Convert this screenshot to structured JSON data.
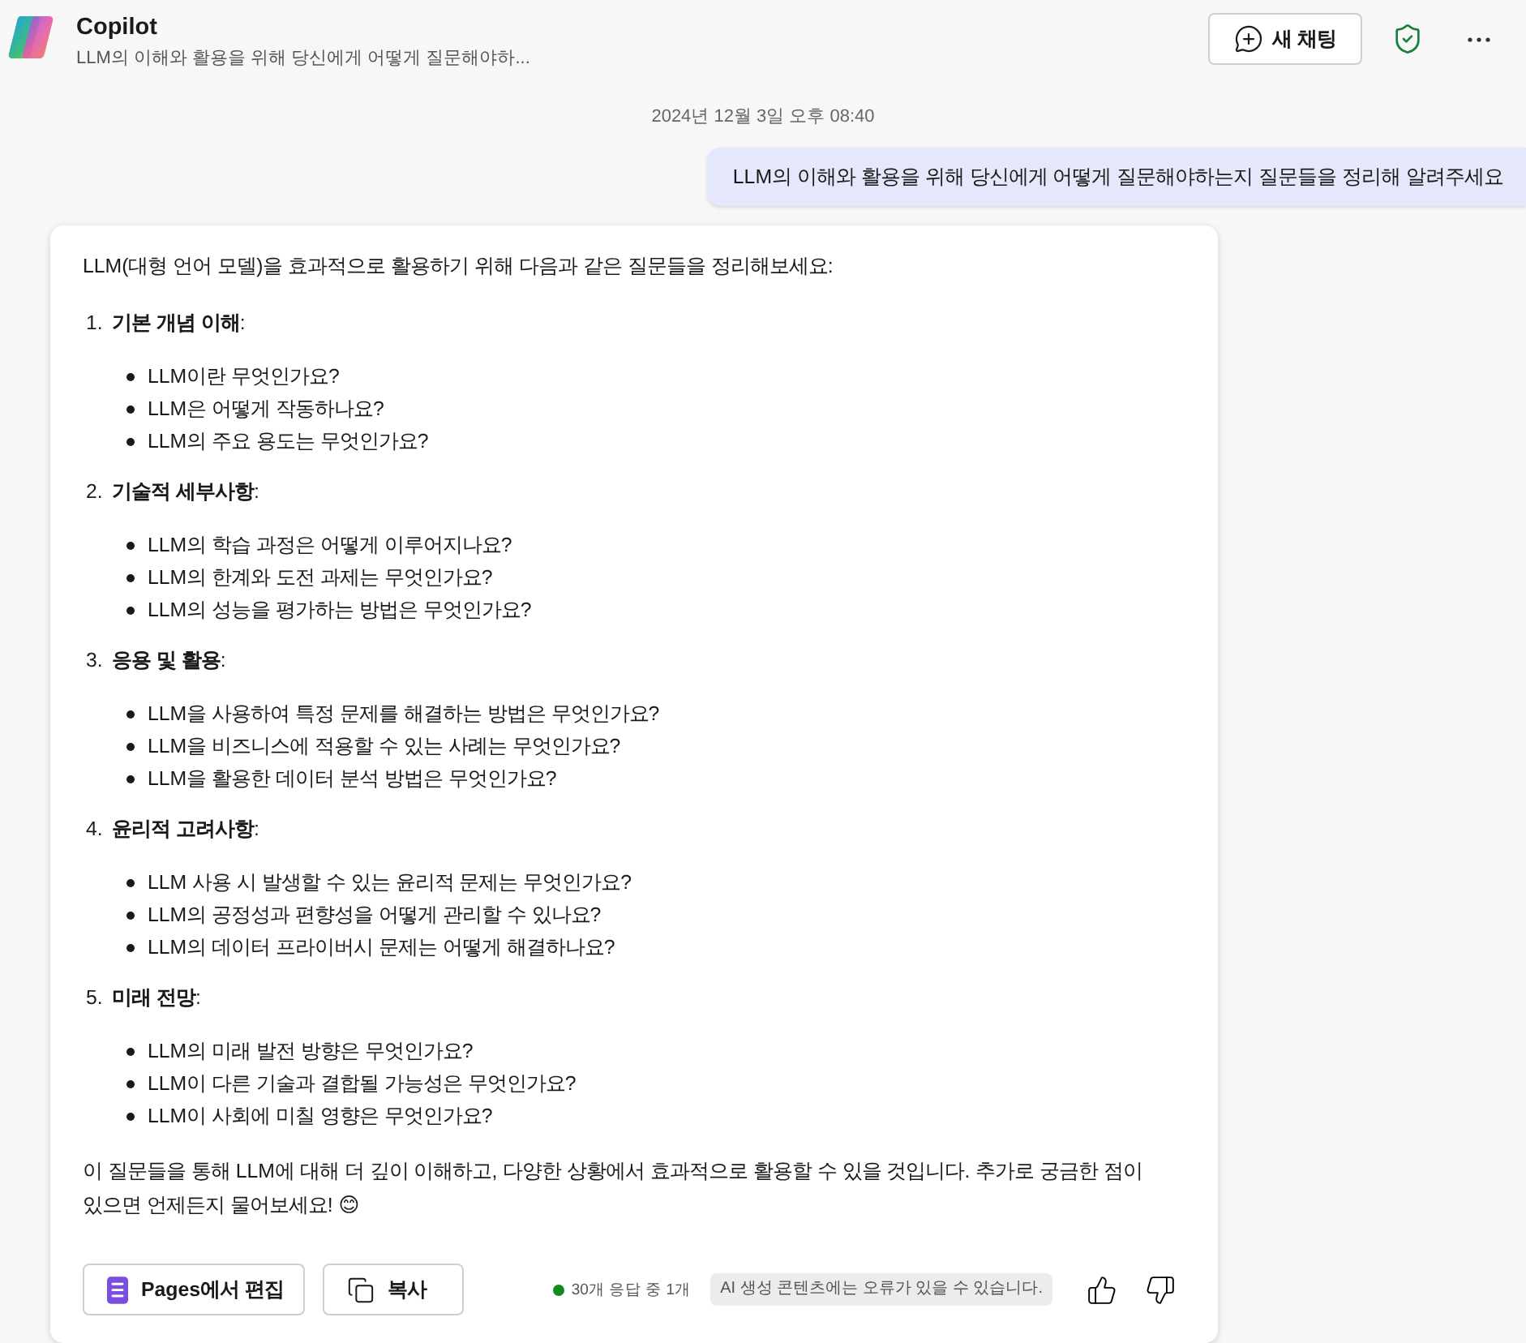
{
  "header": {
    "title": "Copilot",
    "subtitle": "LLM의 이해와 활용을 위해 당신에게 어떻게 질문해야하...",
    "new_chat_button": "새 채팅"
  },
  "timestamp": "2024년 12월 3일 오후 08:40",
  "user_message": "LLM의 이해와 활용을 위해 당신에게 어떻게 질문해야하는지 질문들을 정리해 알려주세요",
  "response": {
    "intro": "LLM(대형 언어 모델)을 효과적으로 활용하기 위해 다음과 같은 질문들을 정리해보세요:",
    "sections": [
      {
        "number": "1.",
        "title": "**기본 개념 이해**:",
        "questions": [
          "LLM이란 무엇인가요?",
          "LLM은 어떻게 작동하나요?",
          "LLM의 주요 용도는 무엇인가요?"
        ]
      },
      {
        "number": "2.",
        "title": "**기술적 세부사항**:",
        "questions": [
          "LLM의 학습 과정은 어떻게 이루어지나요?",
          "LLM의 한계와 도전 과제는 무엇인가요?",
          "LLM의 성능을 평가하는 방법은 무엇인가요?"
        ]
      },
      {
        "number": "3.",
        "title": "**응용 및 활용**:",
        "questions": [
          "LLM을 사용하여 특정 문제를 해결하는 방법은 무엇인가요?",
          "LLM을 비즈니스에 적용할 수 있는 사례는 무엇인가요?",
          "LLM을 활용한 데이터 분석 방법은 무엇인가요?"
        ]
      },
      {
        "number": "4.",
        "title": "**윤리적 고려사항**:",
        "questions": [
          "LLM 사용 시 발생할 수 있는 윤리적 문제는 무엇인가요?",
          "LLM의 공정성과 편향성을 어떻게 관리할 수 있나요?",
          "LLM의 데이터 프라이버시 문제는 어떻게 해결하나요?"
        ]
      },
      {
        "number": "5.",
        "title": "**미래 전망**:",
        "questions": [
          "LLM의 미래 발전 방향은 무엇인가요?",
          "LLM이 다른 기술과 결합될 가능성은 무엇인가요?",
          "LLM이 사회에 미칠 영향은 무엇인가요?"
        ]
      }
    ],
    "closing": "이 질문들을 통해 LLM에 대해 더 깊이 이해하고, 다양한 상황에서 효과적으로 활용할 수 있을 것입니다. 추가로 궁금한 점이 있으면 언제든지 물어보세요! 😊"
  },
  "footer": {
    "buttons": [
      {
        "kind": "pages",
        "label": "Pages에서 편집"
      },
      {
        "kind": "copy",
        "label": "복사"
      }
    ],
    "response_count": "30개 응답 중 1개",
    "disclaimer": "AI 생성 콘텐츠에는 오류가 있을 수 있습니다."
  }
}
